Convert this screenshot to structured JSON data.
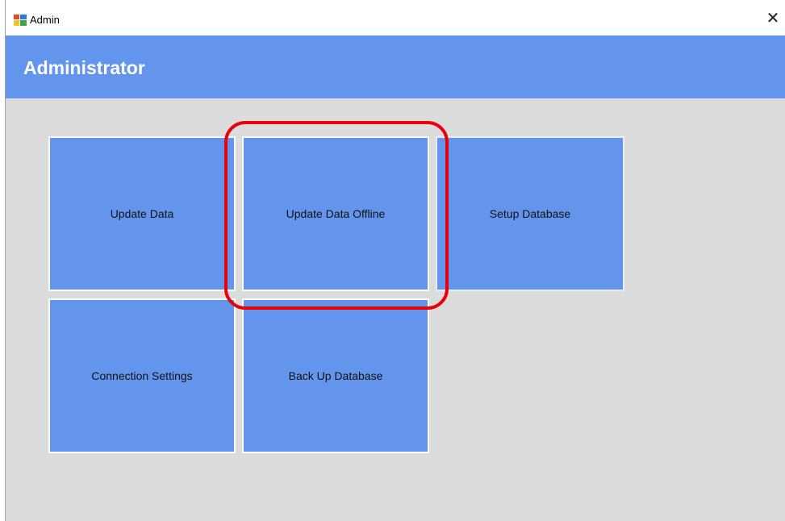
{
  "window": {
    "title": "Admin",
    "close_glyph": "✕"
  },
  "header": {
    "title": "Administrator",
    "background_color": "#6495ed"
  },
  "tiles": [
    {
      "label": "Update Data"
    },
    {
      "label": "Update Data Offline"
    },
    {
      "label": "Setup Database"
    },
    {
      "label": "Connection Settings"
    },
    {
      "label": "Back Up Database"
    }
  ],
  "annotation": {
    "type": "highlight-ring",
    "target": "Update Data Offline",
    "color": "#e8000b"
  },
  "colors": {
    "tile": "#6495ed",
    "body": "#dcdcdc"
  }
}
